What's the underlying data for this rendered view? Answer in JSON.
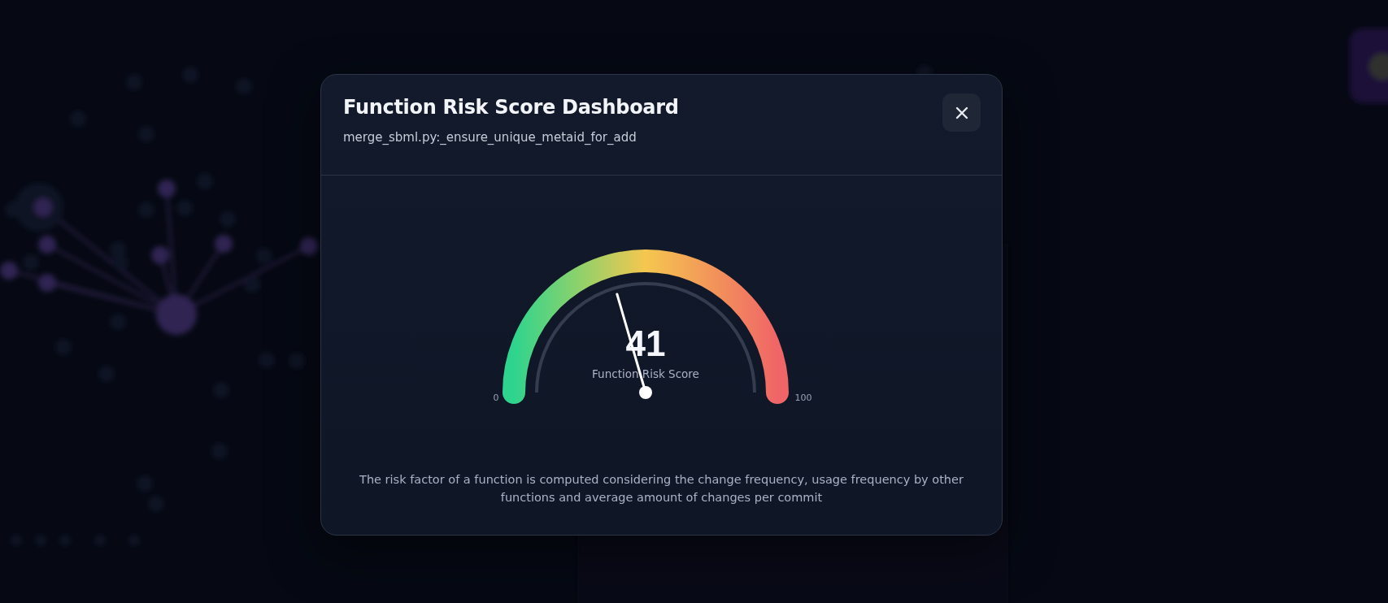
{
  "modal": {
    "title": "Function Risk Score Dashboard",
    "subtitle": "merge_sbml.py:_ensure_unique_metaid_for_add",
    "gauge": {
      "value": "41",
      "label": "Function Risk Score",
      "level": 0.41,
      "min_label": "0",
      "max_label": "100"
    },
    "description": "The risk factor of a function is computed considering the change frequency, usage frequency by other functions and average amount of changes per commit"
  }
}
